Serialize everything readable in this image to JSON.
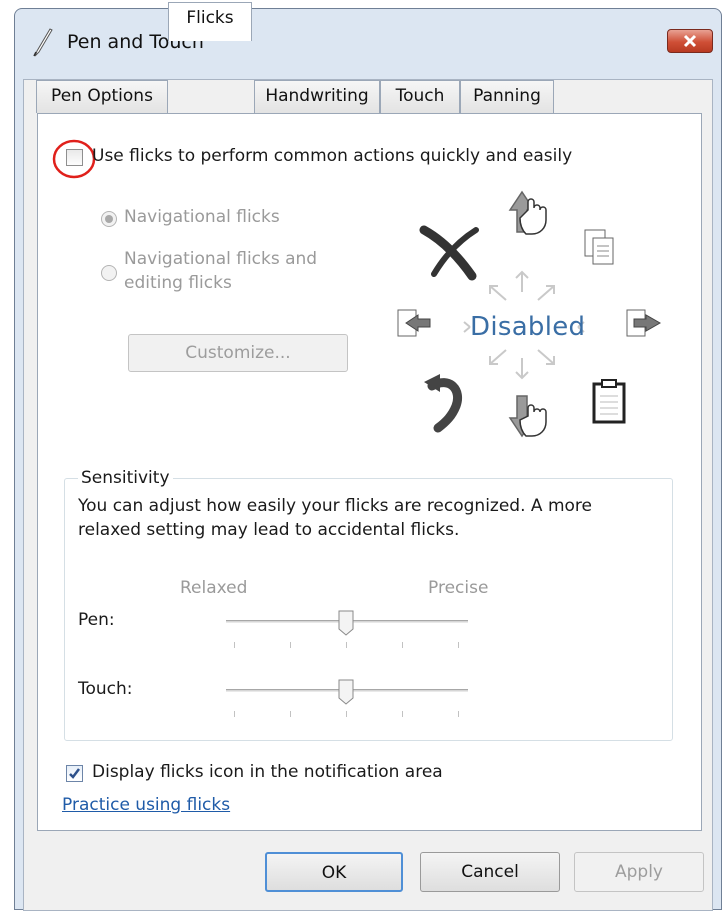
{
  "window": {
    "title": "Pen and Touch"
  },
  "tabs": [
    {
      "label": "Pen Options"
    },
    {
      "label": "Flicks"
    },
    {
      "label": "Handwriting"
    },
    {
      "label": "Touch"
    },
    {
      "label": "Panning"
    }
  ],
  "active_tab": "Flicks",
  "flicks": {
    "enable_label": "Use flicks to perform common actions quickly and easily",
    "enable_checked": false,
    "radio_navigational": "Navigational flicks",
    "radio_navigational_editing_line1": "Navigational flicks and",
    "radio_navigational_editing_line2": "editing flicks",
    "selected_radio": "Navigational flicks",
    "customize_button": "Customize...",
    "diagram_status": "Disabled"
  },
  "sensitivity": {
    "group_title": "Sensitivity",
    "description_line1": "You can adjust how easily your flicks are recognized. A more",
    "description_line2": "relaxed setting may lead to accidental flicks.",
    "scale_left": "Relaxed",
    "scale_right": "Precise",
    "pen_label": "Pen:",
    "touch_label": "Touch:",
    "pen_level": 0.5,
    "touch_level": 0.5
  },
  "notification": {
    "label": "Display flicks icon in the notification area",
    "checked": true
  },
  "practice_link": "Practice using flicks",
  "buttons": {
    "ok": "OK",
    "cancel": "Cancel",
    "apply": "Apply"
  },
  "colors": {
    "highlight_circle": "#e0201b",
    "link": "#1f5ba8",
    "disabled_text": "#9a9a9a"
  }
}
